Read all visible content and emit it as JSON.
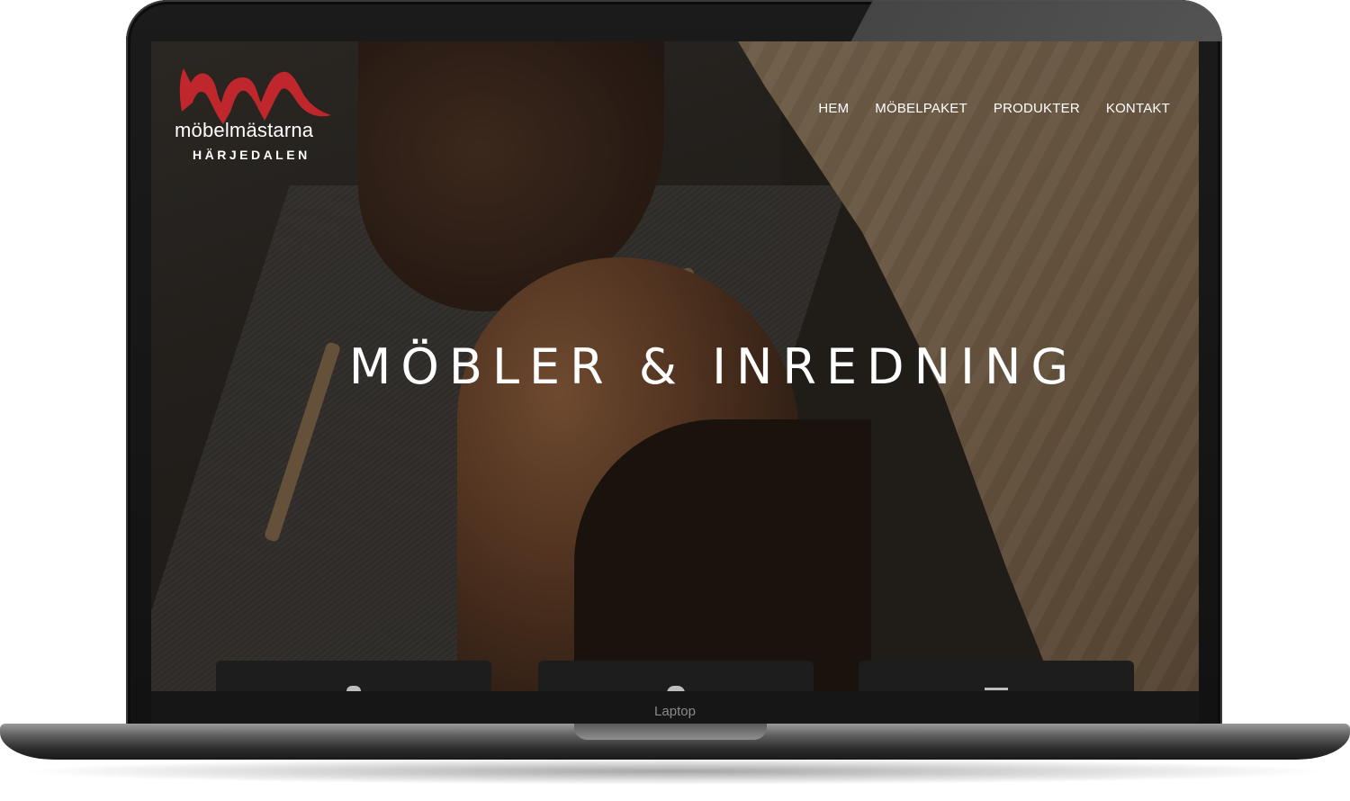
{
  "device": {
    "label": "Laptop"
  },
  "site": {
    "brand": {
      "name": "möbelmästarna",
      "subtitle": "HÄRJEDALEN",
      "accent_color": "#c0272d"
    },
    "nav": [
      {
        "label": "HEM"
      },
      {
        "label": "MÖBELPAKET"
      },
      {
        "label": "PRODUKTER"
      },
      {
        "label": "KONTAKT"
      }
    ],
    "hero": {
      "title": "MÖBLER & INREDNING"
    },
    "cards": [
      {
        "icon": "person-icon"
      },
      {
        "icon": "circle-icon"
      },
      {
        "icon": "box-icon"
      }
    ]
  }
}
